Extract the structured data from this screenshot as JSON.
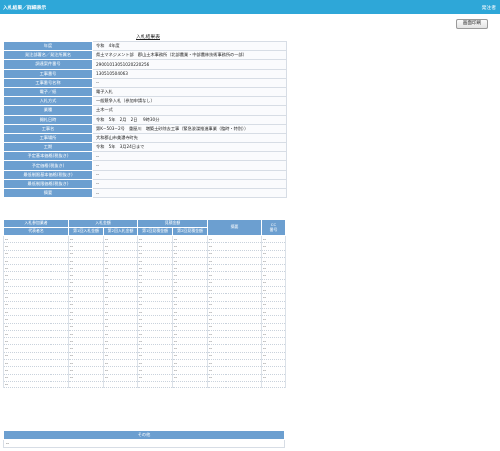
{
  "header": {
    "title": "入札結果／詳細表示",
    "user": "発注者"
  },
  "toolbar": {
    "print_label": "画面印刷"
  },
  "section_title": "入札結果表",
  "info_rows": [
    {
      "label": "年度",
      "value": "令和　4年度"
    },
    {
      "label": "発注部署名／発注所属名",
      "value": "県土マネジメント部　郡山土木事務所（北部農業・中部農林技術事務所の一部）"
    },
    {
      "label": "調達案件番号",
      "value": "29001013051020220256"
    },
    {
      "label": "工事番号",
      "value": "130510504063"
    },
    {
      "label": "工事番号名称",
      "value": "--"
    },
    {
      "label": "電子／紙",
      "value": "電子入札"
    },
    {
      "label": "入札方式",
      "value": "一般競争入札（参加申請なし）"
    },
    {
      "label": "業種",
      "value": "土木一式"
    },
    {
      "label": "開札日時",
      "value": "令和　5年　2月　2日　 9時30分"
    },
    {
      "label": "工事名",
      "value": "第K−503−2号　重屋川　増築土砂除去工事（緊急浚渫推進事業（臨時・特別））"
    },
    {
      "label": "工事場所",
      "value": "大和郡山市美濃寺町先"
    },
    {
      "label": "工期",
      "value": "令和　5年　3月24日まで"
    },
    {
      "label": "予定基本価格(税抜き)",
      "value": "--"
    },
    {
      "label": "予定価格(税抜き)",
      "value": "--"
    },
    {
      "label": "最低制限基本価格(税抜き)",
      "value": "--"
    },
    {
      "label": "最低制限価格(税抜き)",
      "value": "--"
    },
    {
      "label": "摘要",
      "value": "--"
    }
  ],
  "bids": {
    "group_headers": {
      "participant": "入札参加業者",
      "bid_amount": "入札金額",
      "negotiation_amount": "見積金額",
      "remarks": "摘要",
      "cc": "CC\n番号"
    },
    "sub_headers": {
      "company": "代表者名",
      "first_bid": "第1回入札金額",
      "second_bid": "第2回入札金額",
      "first_neg": "第1回見積金額",
      "second_neg": "第2回見積金額"
    },
    "placeholder": "--",
    "row_count": 21
  },
  "other": {
    "title": "その他",
    "value": "--"
  }
}
